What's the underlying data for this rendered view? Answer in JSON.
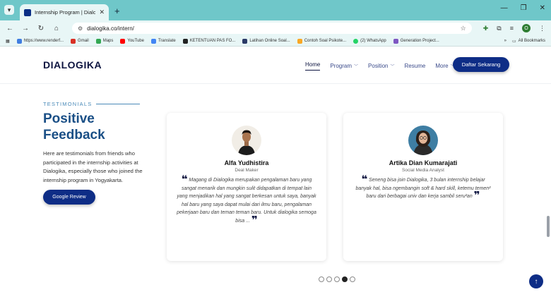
{
  "browser": {
    "tab_title": "Internship Program | Dialogika",
    "url": "dialogika.co/intern/",
    "bookmarks": [
      "https://www.renderf...",
      "Gmail",
      "Maps",
      "YouTube",
      "Translate",
      "KETENTUAN PAS FO...",
      "Latihan Online Soal...",
      "Contoh Soal Psikote...",
      "(2) WhatsApp",
      "Generation Project..."
    ],
    "all_bookmarks": "All Bookmarks",
    "profile_initial": "O",
    "colors": {
      "chrome": "#6fc7c9",
      "toolbar": "#e8f6f6"
    }
  },
  "site": {
    "logo": "DIALOGIKA",
    "nav": [
      {
        "label": "Home",
        "active": true
      },
      {
        "label": "Program",
        "dropdown": true
      },
      {
        "label": "Position",
        "dropdown": true
      },
      {
        "label": "Resume"
      },
      {
        "label": "More",
        "dropdown": true
      }
    ],
    "cta": "Daftar Sekarang",
    "brand_color": "#0e2d86"
  },
  "section": {
    "eyebrow": "TESTIMONIALS",
    "headline_line1": "Positive",
    "headline_line2": "Feedback",
    "intro": "Here are testimonials from friends who participated in the internship activities at Dialogika, especially those who joined the internship program in Yogyakarta.",
    "review_button": "Google Review"
  },
  "testimonials": [
    {
      "name": "Alfa Yudhistira",
      "role": "Deal Maker",
      "quote": "Magang di Dialogika merupakan pengalaman baru yang sangat menarik dan mungkin sulit didapatkan di tempat lain yang menjadikan hal yang sangat berkesan untuk saya, banyak hal baru yang saya dapat mulai dari ilmu baru, pengalaman pekerjaan baru dan teman teman baru. Untuk dialogika semoga bisa ..."
    },
    {
      "name": "Artika Dian Kumarajati",
      "role": "Social Media Analyst",
      "quote": "Seneng bisa join Dialogika, 3 bulan internship belajar banyak hal, bisa ngembangin soft & hard skill, ketemu temen² baru dari berbagai univ dan kerja sambil seru²an"
    }
  ],
  "carousel": {
    "total": 5,
    "active_index": 3
  },
  "back_to_top": "↑"
}
